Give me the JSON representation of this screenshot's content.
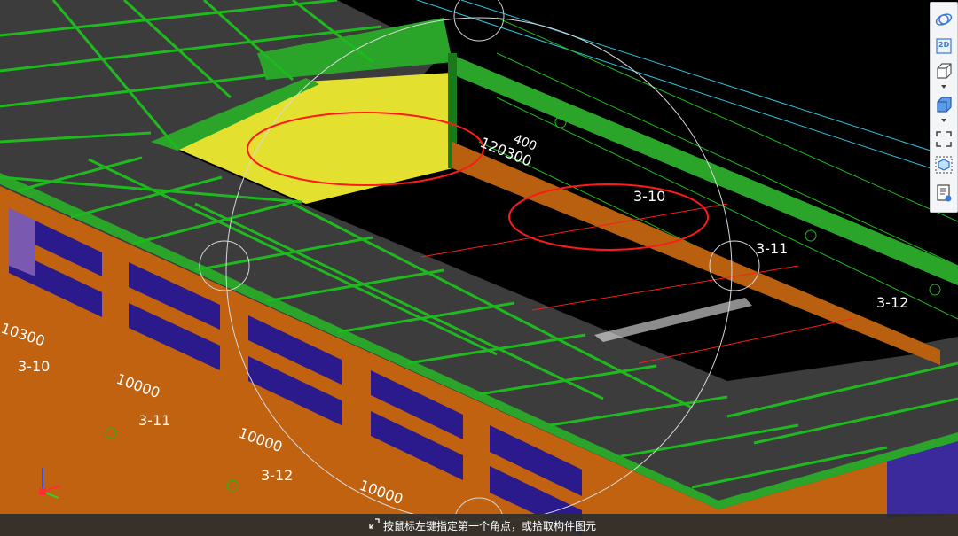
{
  "viewport": {
    "grid_labels": [
      "3-10",
      "3-11",
      "3-12",
      "3-10",
      "3-11",
      "3-12"
    ],
    "dimension_labels": [
      "120300",
      "10000",
      "10000",
      "10000",
      "10300",
      "400"
    ],
    "colors": {
      "roof_green": "#2aa52a",
      "slab_gray": "#3c3c3c",
      "wall_orange": "#c0620f",
      "window_blue": "#2a1a8c",
      "highlight_yellow": "#e4e030",
      "annotation_red": "#ff1a1a",
      "axis_cyan": "#2ec4e0",
      "grid_line_green": "#1fb81f"
    }
  },
  "toolbar": {
    "items": [
      "orbit-icon",
      "2d-view-icon",
      "3d-view-icon",
      "dropdown-icon",
      "cube-view-icon",
      "dropdown-icon",
      "zoom-extents-icon",
      "display-settings-icon",
      "properties-icon"
    ],
    "view_2d_label": "2D"
  },
  "statusbar": {
    "prompt": "按鼠标左键指定第一个角点，或拾取构件图元"
  }
}
